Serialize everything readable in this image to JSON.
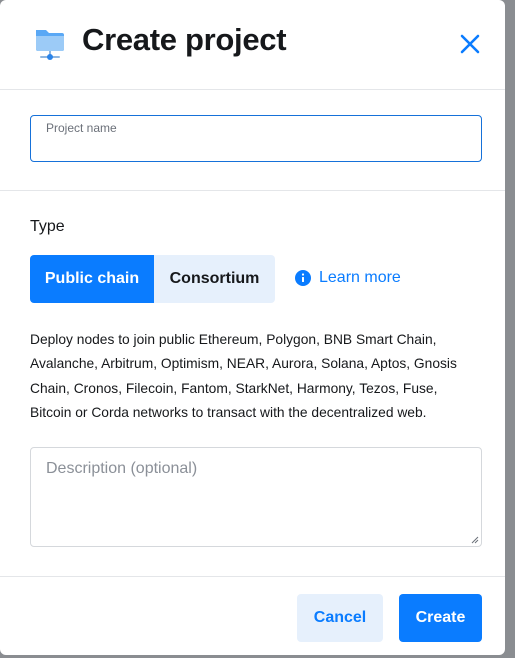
{
  "dialog": {
    "title": "Create project",
    "logo_icon": "project-folder-icon",
    "close_icon": "close-icon"
  },
  "name_field": {
    "label": "Project name",
    "value": ""
  },
  "type": {
    "label": "Type",
    "options": [
      "Public chain",
      "Consortium"
    ],
    "selected": "Public chain",
    "learn_more": "Learn more",
    "learn_more_icon": "info-icon"
  },
  "description_text": "Deploy nodes to join public Ethereum, Polygon, BNB Smart Chain, Avalanche, Arbitrum, Optimism, NEAR, Aurora, Solana, Aptos, Gnosis Chain, Cronos, Filecoin, Fantom, StarkNet, Harmony, Tezos, Fuse, Bitcoin or Corda networks to transact with the decentralized web.",
  "description_field": {
    "placeholder": "Description (optional)",
    "value": ""
  },
  "footer": {
    "cancel": "Cancel",
    "create": "Create"
  },
  "colors": {
    "primary": "#0a7cff",
    "primary_light": "#e6f0fc",
    "text": "#16181b",
    "border": "#e4e6e9"
  }
}
